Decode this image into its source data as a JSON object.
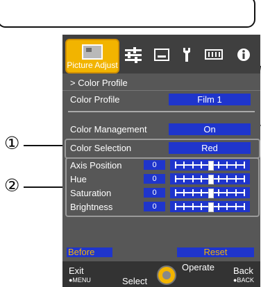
{
  "tabs": {
    "active_label": "Picture Adjust"
  },
  "breadcrumb": "> Color Profile",
  "rows": {
    "color_profile": {
      "label": "Color Profile",
      "value": "Film 1"
    },
    "color_management": {
      "label": "Color Management",
      "value": "On"
    },
    "color_selection": {
      "label": "Color Selection",
      "value": "Red"
    }
  },
  "sliders": [
    {
      "label": "Axis Position",
      "value": "0",
      "level_fraction": 0.5
    },
    {
      "label": "Hue",
      "value": "0",
      "level_fraction": 0.5
    },
    {
      "label": "Saturation",
      "value": "0",
      "level_fraction": 0.5
    },
    {
      "label": "Brightness",
      "value": "0",
      "level_fraction": 0.5
    }
  ],
  "footer_buttons": {
    "before": "Before",
    "reset": "Reset"
  },
  "bottom_bar": {
    "exit": "Exit",
    "menu": "●MENU",
    "select": "Select",
    "operate": "Operate",
    "back": "Back",
    "back_key": "●BACK"
  },
  "callouts": {
    "one": "①",
    "two": "②"
  },
  "colors": {
    "accent": "#f2b400",
    "value_bg": "#1f35cc",
    "menu_bg": "#575757"
  }
}
